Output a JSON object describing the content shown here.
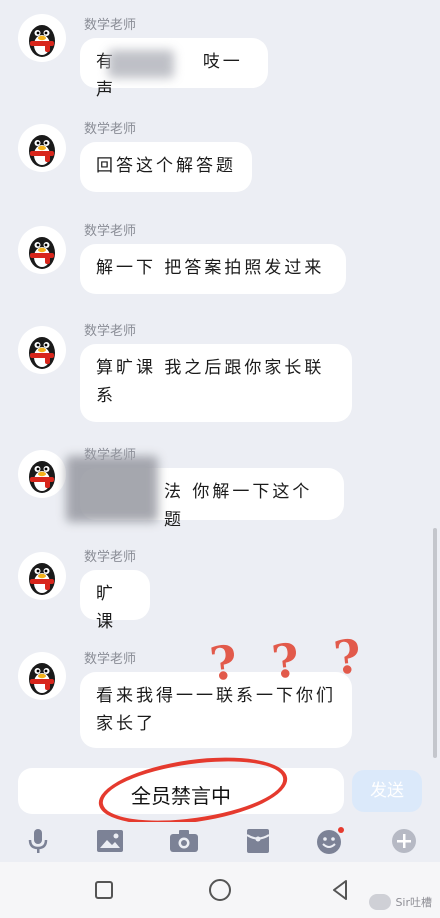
{
  "chat": {
    "messages": [
      {
        "sender": "数学老师",
        "text_visible_a": "有",
        "text_visible_b": "吱一声",
        "blurred": true
      },
      {
        "sender": "数学老师",
        "text": "回答这个解答题"
      },
      {
        "sender": "数学老师",
        "text": "解一下 把答案拍照发过来"
      },
      {
        "sender": "数学老师",
        "text_line1": "算旷课  我之后跟你家长联",
        "text_line2": "系"
      },
      {
        "sender": "数学老师",
        "text_visible": "法 你解一下这个题",
        "blurred": true
      },
      {
        "sender": "数学老师",
        "text": "旷课"
      },
      {
        "sender": "数学老师",
        "text_line1": "看来我得一一联系一下你们",
        "text_line2": "家长了"
      }
    ],
    "annotation_marks": "? ? ?"
  },
  "input": {
    "status_text": "全员禁言中",
    "send_label": "发送"
  },
  "toolbar": {
    "icons": [
      "microphone-icon",
      "image-icon",
      "camera-icon",
      "red-packet-icon",
      "emoji-icon",
      "plus-icon"
    ],
    "emoji_badge_color": "#e53a2e"
  },
  "navbar": {
    "icons": [
      "recent-apps-icon",
      "home-icon",
      "back-icon"
    ]
  },
  "watermark": {
    "text": "Sir吐槽"
  },
  "colors": {
    "background": "#eceef4",
    "bubble": "#ffffff",
    "annotation_red": "#e53a2e",
    "send_button": "#dbe9fa"
  }
}
